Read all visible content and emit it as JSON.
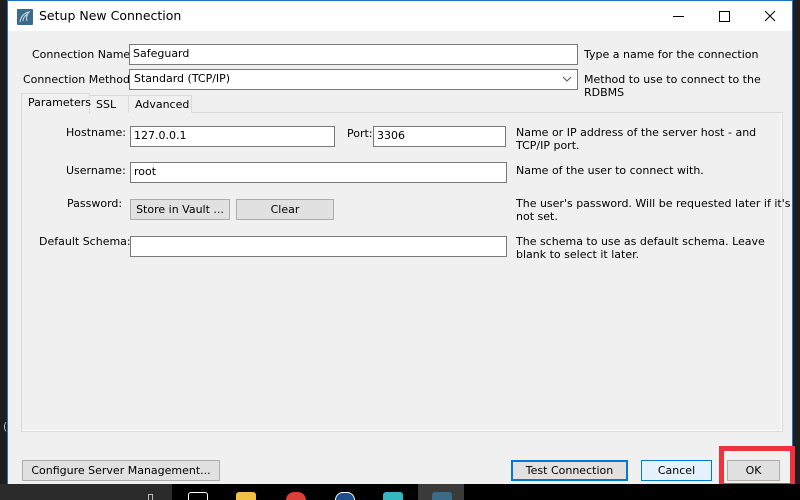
{
  "window": {
    "title": "Setup New Connection",
    "app_icon": "mysql-workbench-dolphin-icon",
    "controls": {
      "minimize": "minimize-icon",
      "maximize": "maximize-icon",
      "close": "close-icon"
    }
  },
  "connection": {
    "name_label": "Connection Name:",
    "name_value": "Safeguard",
    "name_hint": "Type a name for the connection",
    "method_label": "Connection Method:",
    "method_value": "Standard (TCP/IP)",
    "method_hint": "Method to use to connect to the RDBMS"
  },
  "tabs": [
    {
      "label": "Parameters",
      "active": true
    },
    {
      "label": "SSL",
      "active": false
    },
    {
      "label": "Advanced",
      "active": false
    }
  ],
  "parameters": {
    "hostname_label": "Hostname:",
    "hostname_value": "127.0.0.1",
    "port_label": "Port:",
    "port_value": "3306",
    "hostname_hint_line1": "Name or IP address of the server host - and",
    "hostname_hint_line2": "TCP/IP port.",
    "username_label": "Username:",
    "username_value": "root",
    "username_hint": "Name of the user to connect with.",
    "password_label": "Password:",
    "store_in_vault_label": "Store in Vault ...",
    "clear_label": "Clear",
    "password_hint_line1": "The user's password. Will be requested later if it's",
    "password_hint_line2": "not set.",
    "schema_label": "Default Schema:",
    "schema_value": "",
    "schema_hint_line1": "The schema to use as default schema. Leave",
    "schema_hint_line2": "blank to select it later."
  },
  "footer": {
    "configure_label": "Configure Server Management...",
    "test_label": "Test Connection",
    "cancel_label": "Cancel",
    "ok_label": "OK"
  },
  "colors": {
    "accent": "#0078d7",
    "highlight": "#f0323c",
    "window_bg": "#f0f0f0"
  },
  "taskbar": {
    "icons": [
      "task-view-icon",
      "file-explorer-icon",
      "chrome-icon",
      "app-icon",
      "notepad-icon",
      "mysql-workbench-icon"
    ]
  }
}
